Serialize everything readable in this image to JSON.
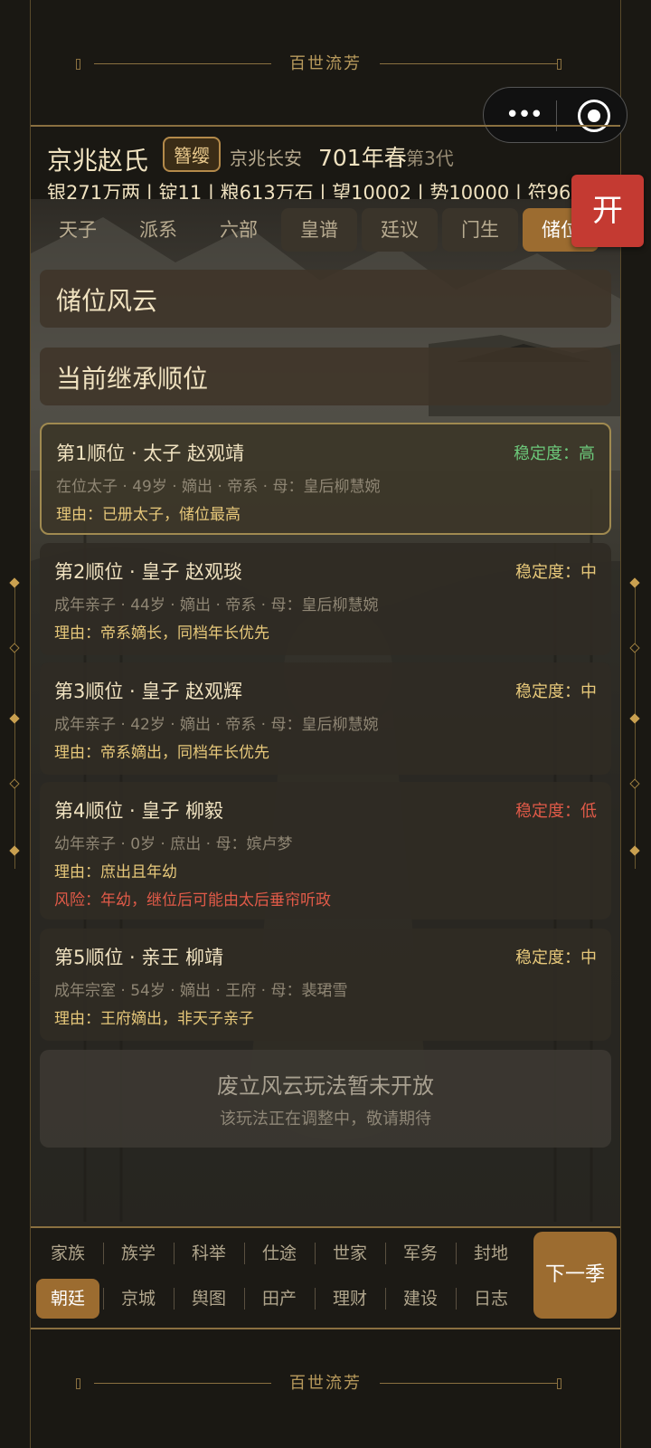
{
  "banner_top": {
    "title": "百世流芳"
  },
  "banner_bottom": {
    "title": "百世流芳"
  },
  "header": {
    "clan": "京兆赵氏",
    "title_badge": "簪缨",
    "location": "京兆长安",
    "year": "701年春",
    "generation": "第3代",
    "resources": "银271万两 | 锭11 | 粮613万石 | 望10002 | 势10000 | 符96"
  },
  "open_button": {
    "label": "开"
  },
  "tabs": [
    {
      "label": "天子"
    },
    {
      "label": "派系"
    },
    {
      "label": "六部"
    },
    {
      "label": "皇谱"
    },
    {
      "label": "廷议"
    },
    {
      "label": "门生"
    },
    {
      "label": "储位"
    }
  ],
  "sections": {
    "main_title": "储位风云",
    "sub_title": "当前继承顺位"
  },
  "succession": [
    {
      "title": "第1顺位 · 太子 赵观靖",
      "stability": "稳定度：高",
      "stability_color": "#6cc87a",
      "info": "在位太子 · 49岁 · 嫡出 · 帝系 · 母：皇后柳慧婉",
      "reason": "理由：已册太子，储位最高"
    },
    {
      "title": "第2顺位 · 皇子 赵观琰",
      "stability": "稳定度：中",
      "stability_color": "#e7c87a",
      "info": "成年亲子 · 44岁 · 嫡出 · 帝系 · 母：皇后柳慧婉",
      "reason": "理由：帝系嫡长，同档年长优先"
    },
    {
      "title": "第3顺位 · 皇子 赵观辉",
      "stability": "稳定度：中",
      "stability_color": "#e7c87a",
      "info": "成年亲子 · 42岁 · 嫡出 · 帝系 · 母：皇后柳慧婉",
      "reason": "理由：帝系嫡出，同档年长优先"
    },
    {
      "title": "第4顺位 · 皇子 柳毅",
      "stability": "稳定度：低",
      "stability_color": "#e05a48",
      "info": "幼年亲子 · 0岁 · 庶出 · 母：嫔卢梦",
      "reason": "理由：庶出且年幼",
      "risk": "风险：年幼，继位后可能由太后垂帘听政"
    },
    {
      "title": "第5顺位 · 亲王 柳靖",
      "stability": "稳定度：中",
      "stability_color": "#e7c87a",
      "info": "成年宗室 · 54岁 · 嫡出 · 王府 · 母：裴珺雪",
      "reason": "理由：王府嫡出，非天子亲子"
    }
  ],
  "notice": {
    "title": "废立风云玩法暂未开放",
    "subtitle": "该玩法正在调整中，敬请期待"
  },
  "bottom_nav": {
    "row1": [
      "家族",
      "族学",
      "科举",
      "仕途",
      "世家",
      "军务",
      "封地"
    ],
    "row2": [
      "朝廷",
      "京城",
      "舆图",
      "田产",
      "理财",
      "建设",
      "日志"
    ],
    "active": "朝廷",
    "next_label": "下一季"
  },
  "colors": {
    "accent_gold": "#9c6c30",
    "open_red": "#c43a32",
    "reason_gold": "#e7c87a",
    "risk_red": "#e05a48"
  }
}
